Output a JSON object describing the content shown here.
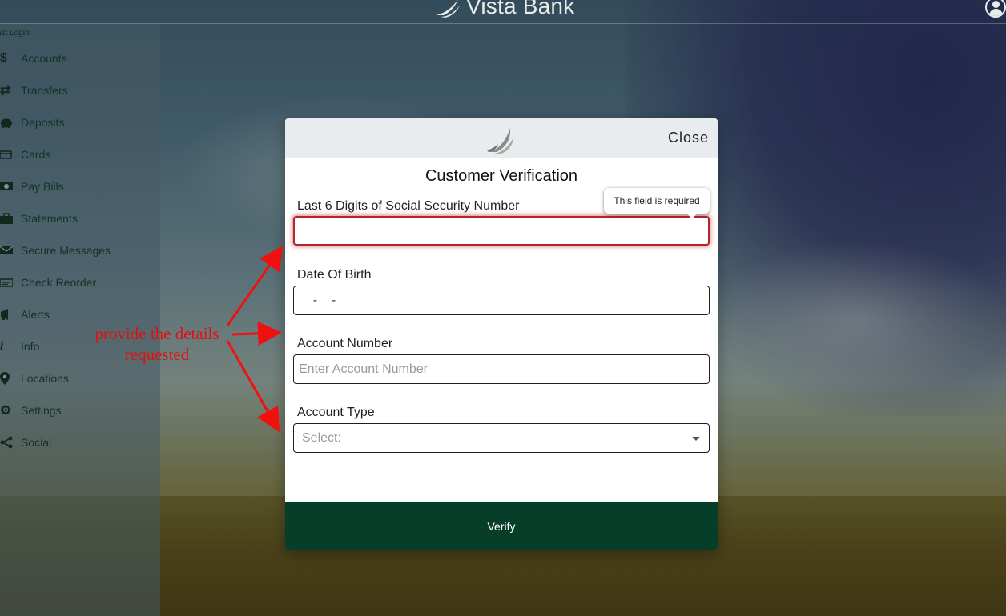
{
  "header": {
    "brand_name": "Vista Bank",
    "profile_icon": "user-icon"
  },
  "sidebar": {
    "last_login_label": "ast Login:",
    "items": [
      {
        "label": "Accounts",
        "icon": "dollar-icon"
      },
      {
        "label": "Transfers",
        "icon": "transfer-icon"
      },
      {
        "label": "Deposits",
        "icon": "piggy-bank-icon"
      },
      {
        "label": "Cards",
        "icon": "cards-icon"
      },
      {
        "label": "Pay Bills",
        "icon": "money-icon"
      },
      {
        "label": "Statements",
        "icon": "briefcase-icon"
      },
      {
        "label": "Secure Messages",
        "icon": "envelope-icon"
      },
      {
        "label": "Check Reorder",
        "icon": "check-icon"
      },
      {
        "label": "Alerts",
        "icon": "bullhorn-icon"
      },
      {
        "label": "Info",
        "icon": "info-icon"
      },
      {
        "label": "Locations",
        "icon": "map-pin-icon"
      },
      {
        "label": "Settings",
        "icon": "gear-icon"
      },
      {
        "label": "Social",
        "icon": "share-icon"
      }
    ]
  },
  "modal": {
    "close_label": "Close",
    "title": "Customer Verification",
    "ssn": {
      "label": "Last 6 Digits of Social Security Number",
      "value": "",
      "error_tooltip": "This field is required"
    },
    "dob": {
      "label": "Date Of Birth",
      "value": "__-__-____"
    },
    "account_number": {
      "label": "Account Number",
      "placeholder": "Enter Account Number",
      "value": ""
    },
    "account_type": {
      "label": "Account Type",
      "selected": "Select:"
    },
    "verify_label": "Verify"
  },
  "annotation": {
    "line1": "provide the details",
    "line2": "requested",
    "color": "#e01010"
  },
  "colors": {
    "primary_green": "#073e2a",
    "error_red": "#b2262b"
  }
}
